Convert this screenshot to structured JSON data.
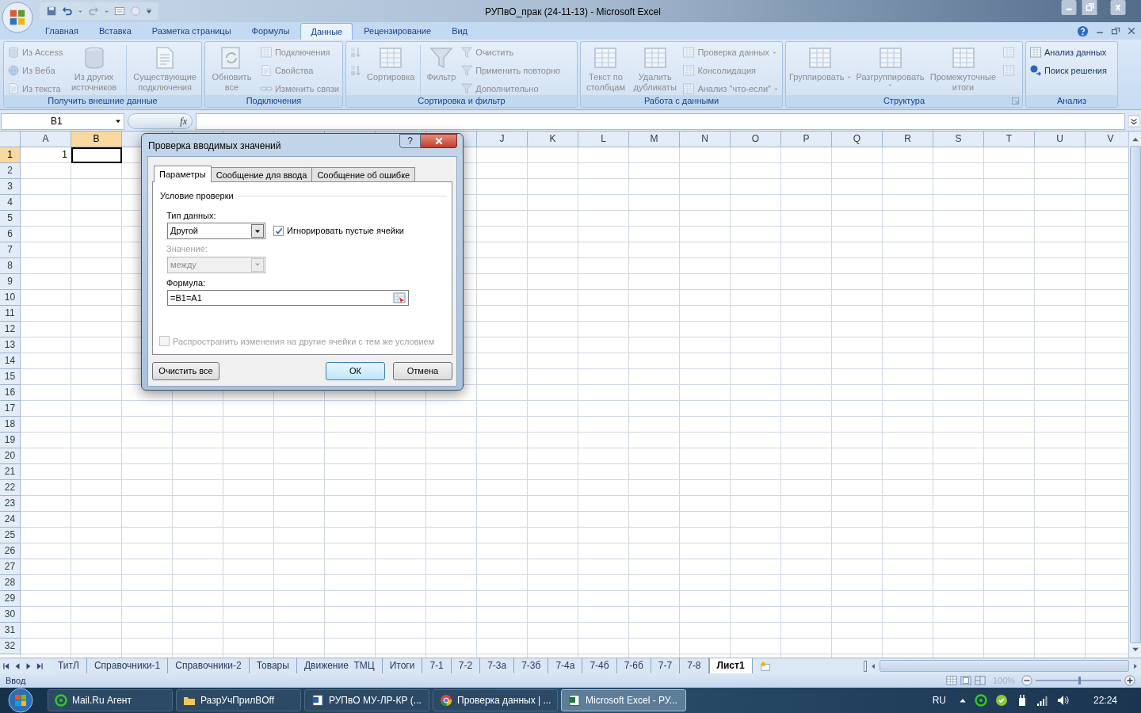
{
  "window": {
    "title": "РУПвО_прак (24-11-13) - Microsoft Excel"
  },
  "ribbon": {
    "tabs": [
      {
        "label": "Главная",
        "selected": false
      },
      {
        "label": "Вставка",
        "selected": false
      },
      {
        "label": "Разметка страницы",
        "selected": false
      },
      {
        "label": "Формулы",
        "selected": false
      },
      {
        "label": "Данные",
        "selected": true
      },
      {
        "label": "Рецензирование",
        "selected": false
      },
      {
        "label": "Вид",
        "selected": false
      }
    ],
    "groups": [
      {
        "label": "Получить внешние данные",
        "items": [
          {
            "kind": "small",
            "label": "Из Access",
            "disabled": true
          },
          {
            "kind": "small",
            "label": "Из Веба",
            "disabled": true
          },
          {
            "kind": "small",
            "label": "Из текста",
            "disabled": true
          },
          {
            "kind": "large",
            "label": "Из других источников",
            "disabled": true,
            "dropdown": true
          },
          {
            "kind": "separator"
          },
          {
            "kind": "large",
            "label": "Существующие подключения",
            "disabled": true
          }
        ]
      },
      {
        "label": "Подключения",
        "items": [
          {
            "kind": "large",
            "label": "Обновить все",
            "disabled": true,
            "dropdown": true
          },
          {
            "kind": "small",
            "label": "Подключения",
            "disabled": true
          },
          {
            "kind": "small",
            "label": "Свойства",
            "disabled": true
          },
          {
            "kind": "small",
            "label": "Изменить связи",
            "disabled": true
          }
        ]
      },
      {
        "label": "Сортировка и фильтр",
        "items": [
          {
            "kind": "small",
            "disabled": true
          },
          {
            "kind": "small",
            "disabled": true
          },
          {
            "kind": "large",
            "label": "Сортировка",
            "disabled": true
          },
          {
            "kind": "separator"
          },
          {
            "kind": "large",
            "label": "Фильтр",
            "disabled": true
          },
          {
            "kind": "small",
            "label": "Очистить",
            "disabled": true
          },
          {
            "kind": "small",
            "label": "Применить повторно",
            "disabled": true
          },
          {
            "kind": "small",
            "label": "Дополнительно",
            "disabled": true
          }
        ]
      },
      {
        "label": "Работа с данными",
        "items": [
          {
            "kind": "large",
            "label": "Текст по столбцам",
            "disabled": true
          },
          {
            "kind": "large",
            "label": "Удалить дубликаты",
            "disabled": true
          },
          {
            "kind": "small",
            "label": "Проверка данных",
            "disabled": true,
            "dropdown": true
          },
          {
            "kind": "small",
            "label": "Консолидация",
            "disabled": true
          },
          {
            "kind": "small",
            "label": "Анализ \"что-если\"",
            "disabled": true,
            "dropdown": true
          }
        ]
      },
      {
        "label": "Структура",
        "items": [
          {
            "kind": "large",
            "label": "Группировать",
            "disabled": true,
            "dropdown": true
          },
          {
            "kind": "large",
            "label": "Разгруппировать",
            "disabled": true,
            "dropdown": true
          },
          {
            "kind": "large",
            "label": "Промежуточные итоги",
            "disabled": true
          },
          {
            "kind": "small",
            "disabled": true
          },
          {
            "kind": "small",
            "disabled": true
          }
        ]
      },
      {
        "label": "Анализ",
        "items": [
          {
            "kind": "small",
            "label": "Анализ данных",
            "disabled": false
          },
          {
            "kind": "small",
            "label": "Поиск решения",
            "disabled": false
          }
        ]
      }
    ]
  },
  "formula_bar": {
    "name_box": "B1",
    "function_button": "fx"
  },
  "sheet": {
    "columns": [
      {
        "label": "A",
        "selected": false
      },
      {
        "label": "B",
        "selected": true
      },
      {
        "selected": false
      },
      {
        "selected": false
      },
      {
        "selected": false
      },
      {
        "selected": false
      },
      {
        "selected": false
      },
      {
        "selected": false
      },
      {
        "selected": false
      },
      {
        "label": "J",
        "selected": false
      },
      {
        "label": "K",
        "selected": false
      },
      {
        "label": "L",
        "selected": false
      },
      {
        "label": "M",
        "selected": false
      },
      {
        "label": "N",
        "selected": false
      },
      {
        "label": "O",
        "selected": false
      },
      {
        "label": "P",
        "selected": false
      },
      {
        "label": "Q",
        "selected": false
      },
      {
        "label": "R",
        "selected": false
      },
      {
        "label": "S",
        "selected": false
      },
      {
        "label": "T",
        "selected": false
      },
      {
        "label": "U",
        "selected": false
      },
      {
        "label": "V",
        "selected": false
      }
    ],
    "rows": [
      {
        "label": "1",
        "selected": true,
        "cells": [
          {
            "value": "1",
            "active": false
          },
          {
            "active": true
          }
        ]
      },
      {
        "label": "2",
        "selected": false
      },
      {
        "label": "3",
        "selected": false
      },
      {
        "label": "4",
        "selected": false
      },
      {
        "label": "5",
        "selected": false
      },
      {
        "label": "6",
        "selected": false
      },
      {
        "label": "7",
        "selected": false
      },
      {
        "label": "8",
        "selected": false
      },
      {
        "label": "9",
        "selected": false
      },
      {
        "label": "10",
        "selected": false
      },
      {
        "label": "11",
        "selected": false
      },
      {
        "label": "12",
        "selected": false
      },
      {
        "label": "13",
        "selected": false
      },
      {
        "label": "14",
        "selected": false
      },
      {
        "label": "15",
        "selected": false
      },
      {
        "label": "16",
        "selected": false
      },
      {
        "label": "17",
        "selected": false
      },
      {
        "label": "18",
        "selected": false
      },
      {
        "label": "19",
        "selected": false
      },
      {
        "label": "20",
        "selected": false
      },
      {
        "label": "21",
        "selected": false
      },
      {
        "label": "22",
        "selected": false
      },
      {
        "label": "23",
        "selected": false
      },
      {
        "label": "24",
        "selected": false
      },
      {
        "label": "25",
        "selected": false
      },
      {
        "label": "26",
        "selected": false
      },
      {
        "label": "27",
        "selected": false
      },
      {
        "label": "28",
        "selected": false
      },
      {
        "label": "29",
        "selected": false
      },
      {
        "label": "30",
        "selected": false
      },
      {
        "label": "31",
        "selected": false
      },
      {
        "label": "32",
        "selected": false
      }
    ]
  },
  "sheet_tabs": [
    {
      "label": "ТитЛ",
      "selected": false
    },
    {
      "label": "Справочники-1",
      "selected": false
    },
    {
      "label": "Справочники-2",
      "selected": false
    },
    {
      "label": "Товары",
      "selected": false
    },
    {
      "label": "Движение  ТМЦ",
      "selected": false
    },
    {
      "label": "Итоги",
      "selected": false
    },
    {
      "label": "7-1",
      "selected": false
    },
    {
      "label": "7-2",
      "selected": false
    },
    {
      "label": "7-3а",
      "selected": false
    },
    {
      "label": "7-3б",
      "selected": false
    },
    {
      "label": "7-4а",
      "selected": false
    },
    {
      "label": "7-4б",
      "selected": false
    },
    {
      "label": "7-6б",
      "selected": false
    },
    {
      "label": "7-7",
      "selected": false
    },
    {
      "label": "7-8",
      "selected": false
    },
    {
      "label": "Лист1",
      "selected": true
    }
  ],
  "status_bar": {
    "mode": "Ввод",
    "zoom": "100%",
    "zoom_slider": {
      "level": 0.5
    }
  },
  "dialog": {
    "title": "Проверка вводимых значений",
    "help_button": "?",
    "tabs": [
      {
        "label": "Параметры",
        "selected": true
      },
      {
        "label": "Сообщение для ввода",
        "selected": false
      },
      {
        "label": "Сообщение об ошибке",
        "selected": false
      }
    ],
    "section_title": "Условие проверки",
    "data_type": {
      "label": "Тип данных:",
      "value": "Другой",
      "disabled": false
    },
    "ignore_blank": {
      "label": "Игнорировать пустые ячейки",
      "checked": true,
      "disabled": false
    },
    "value_field": {
      "label": "Значение:",
      "value": "между",
      "disabled": true
    },
    "formula": {
      "label": "Формула:",
      "value": "=B1=A1"
    },
    "apply_to_all": {
      "label": "Распространить изменения на другие ячейки с тем же условием",
      "checked": false,
      "disabled": true
    },
    "buttons": [
      {
        "label": "Очистить все",
        "default": false
      },
      {
        "label": "ОК",
        "default": true
      },
      {
        "label": "Отмена",
        "default": false
      }
    ]
  },
  "taskbar": {
    "items": [
      {
        "label": "Mail.Ru Агент",
        "selected": false
      },
      {
        "label": "РазрУчПрилВOff",
        "selected": false
      },
      {
        "label": "РУПвО МУ-ЛР-КР (...",
        "selected": false
      },
      {
        "label": "Проверка данных | ...",
        "selected": false
      },
      {
        "label": "Microsoft Excel - РУ...",
        "selected": true
      }
    ],
    "language": "RU",
    "clock": "22:24"
  }
}
